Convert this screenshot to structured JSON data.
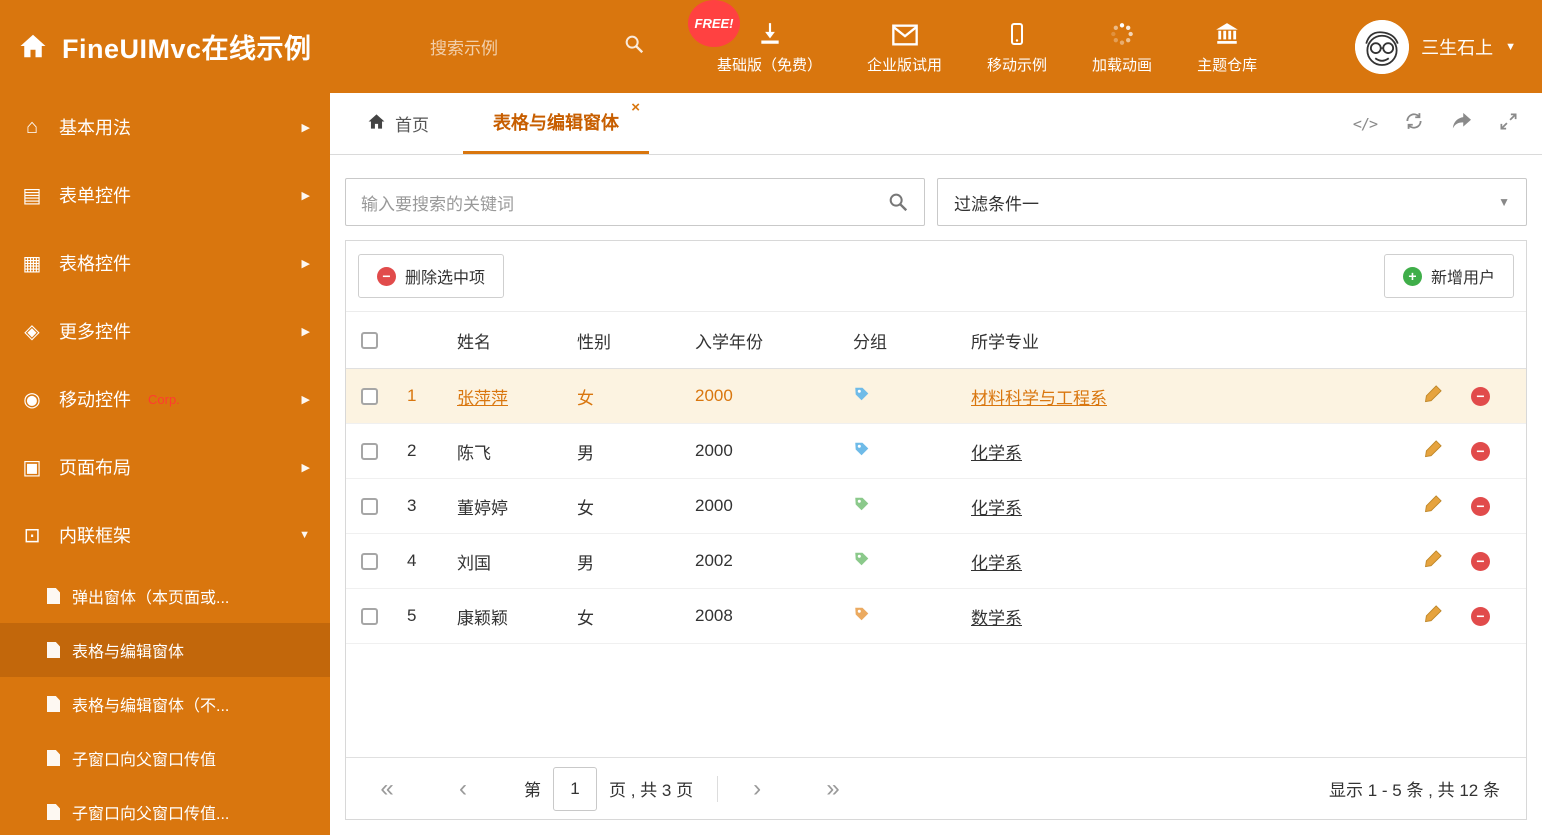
{
  "colors": {
    "accent": "#D9760E",
    "active_tab_text": "#C75E00",
    "free_badge_bg": "#FF4141",
    "delete_red": "#E14B4B",
    "add_green": "#3FAE49",
    "tag_blue": "#6FBBE8",
    "tag_green": "#8BC98B",
    "tag_orange": "#EBAA60",
    "highlight_row_bg": "#FCF3E1"
  },
  "header": {
    "app_title": "FineUIMvc在线示例",
    "search_placeholder": "搜索示例",
    "free_badge": "FREE!",
    "nav": [
      {
        "label": "基础版（免费）"
      },
      {
        "label": "企业版试用"
      },
      {
        "label": "移动示例"
      },
      {
        "label": "加载动画"
      },
      {
        "label": "主题仓库"
      }
    ],
    "username": "三生石上"
  },
  "sidebar": {
    "items": [
      {
        "label": "基本用法"
      },
      {
        "label": "表单控件"
      },
      {
        "label": "表格控件"
      },
      {
        "label": "更多控件"
      },
      {
        "label": "移动控件",
        "badge": "Corp."
      },
      {
        "label": "页面布局"
      },
      {
        "label": "内联框架"
      }
    ],
    "subitems": [
      {
        "label": "弹出窗体（本页面或..."
      },
      {
        "label": "表格与编辑窗体"
      },
      {
        "label": "表格与编辑窗体（不..."
      },
      {
        "label": "子窗口向父窗口传值"
      },
      {
        "label": "子窗口向父窗口传值..."
      }
    ]
  },
  "tabs": {
    "home": "首页",
    "active": "表格与编辑窗体"
  },
  "filter": {
    "search_placeholder": "输入要搜索的关键词",
    "dropdown_value": "过滤条件一"
  },
  "toolbar": {
    "delete": "删除选中项",
    "add": "新增用户"
  },
  "table": {
    "columns": {
      "name": "姓名",
      "gender": "性别",
      "year": "入学年份",
      "group": "分组",
      "major": "所学专业"
    },
    "rows": [
      {
        "num": "1",
        "name": "张萍萍",
        "gender": "女",
        "year": "2000",
        "tag": "blue",
        "major": "材料科学与工程系"
      },
      {
        "num": "2",
        "name": "陈飞",
        "gender": "男",
        "year": "2000",
        "tag": "blue",
        "major": "化学系"
      },
      {
        "num": "3",
        "name": "董婷婷",
        "gender": "女",
        "year": "2000",
        "tag": "green",
        "major": "化学系"
      },
      {
        "num": "4",
        "name": "刘国",
        "gender": "男",
        "year": "2002",
        "tag": "green",
        "major": "化学系"
      },
      {
        "num": "5",
        "name": "康颖颖",
        "gender": "女",
        "year": "2008",
        "tag": "orange",
        "major": "数学系"
      }
    ]
  },
  "pagination": {
    "label_page": "第",
    "current_page": "1",
    "label_total": "页 , 共 3 页",
    "summary": "显示 1 - 5 条 , 共 12 条"
  }
}
